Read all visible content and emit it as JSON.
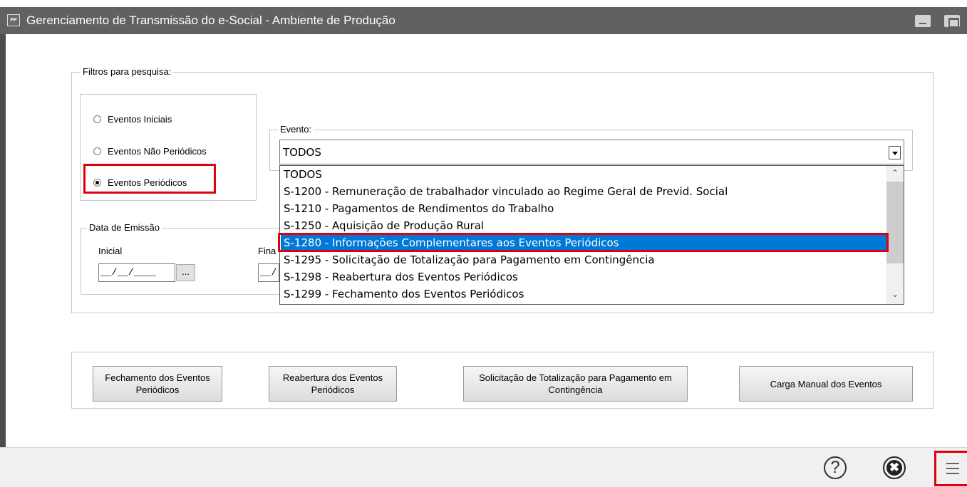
{
  "window": {
    "app_icon_text": "FP",
    "title": "Gerenciamento de Transmissão do e-Social - Ambiente de Produção"
  },
  "filters": {
    "legend": "Filtros para pesquisa:",
    "radios": [
      {
        "label": "Eventos Iniciais",
        "checked": false
      },
      {
        "label": "Eventos Não Periódicos",
        "checked": false
      },
      {
        "label": "Eventos Periódicos",
        "checked": true
      }
    ]
  },
  "evento": {
    "legend": "Evento:",
    "selected": "TODOS",
    "options": [
      "TODOS",
      "S-1200 - Remuneração de trabalhador vinculado ao Regime Geral de Previd. Social",
      "S-1210 - Pagamentos de Rendimentos do Trabalho",
      "S-1250 - Aquisição de Produção Rural",
      "S-1280 - Informações Complementares aos Eventos Periódicos",
      "S-1295 - Solicitação de Totalização para Pagamento em Contingência",
      "S-1298 - Reabertura dos Eventos Periódicos",
      "S-1299 - Fechamento dos Eventos Periódicos"
    ],
    "highlighted": "S-1280 - Informações Complementares aos Eventos Periódicos"
  },
  "data_emissao": {
    "legend": "Data de Emissão",
    "inicial_label": "Inicial",
    "final_label": "Fina",
    "inicial_value": "__/__/____",
    "final_value": "__/",
    "browse_label": "..."
  },
  "actions": {
    "fechamento_label": "Fechamento dos Eventos Periódicos",
    "reabertura_label": "Reabertura dos Eventos Periódicos",
    "totalizacao_label": "Solicitação de Totalização para Pagamento em Contingência",
    "carga_label": "Carga Manual dos Eventos"
  },
  "footer": {
    "help_glyph": "?",
    "close_glyph": "✖"
  },
  "colors": {
    "titlebar": "#616161",
    "highlight": "#e0000f",
    "selection": "#0078d7"
  }
}
